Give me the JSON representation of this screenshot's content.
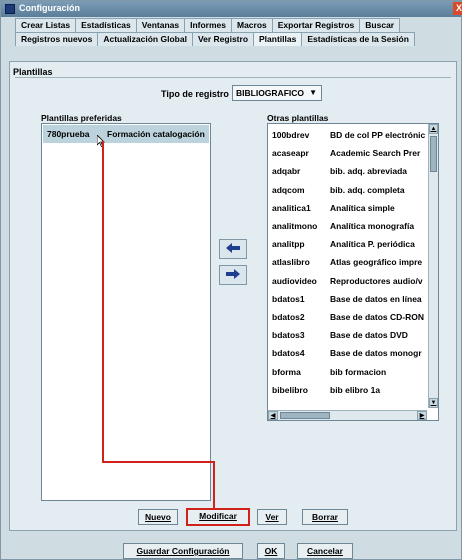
{
  "window": {
    "title": "Configuración",
    "close_label": "X"
  },
  "tabs_row1": [
    {
      "label": "Crear Listas"
    },
    {
      "label": "Estadísticas"
    },
    {
      "label": "Ventanas"
    },
    {
      "label": "Informes"
    },
    {
      "label": "Macros"
    },
    {
      "label": "Exportar Registros"
    },
    {
      "label": "Buscar"
    }
  ],
  "tabs_row2": [
    {
      "label": "Registros nuevos"
    },
    {
      "label": "Actualización Global"
    },
    {
      "label": "Ver Registro"
    },
    {
      "label": "Plantillas",
      "active": true
    },
    {
      "label": "Estadísticas de la Sesión"
    }
  ],
  "section": {
    "title": "Plantillas"
  },
  "tipo_registro": {
    "label": "Tipo de registro",
    "value": "BIBLIOGRAFICO",
    "arrow": "▼"
  },
  "preferidas": {
    "label": "Plantillas preferidas",
    "rows": [
      {
        "code": "780prueba",
        "name": "Formación catalogación"
      }
    ]
  },
  "otras": {
    "label": "Otras plantillas",
    "rows": [
      {
        "code": "100bdrev",
        "name": "BD de col PP electrónic"
      },
      {
        "code": "acaseapr",
        "name": "Academic Search Prer"
      },
      {
        "code": "adqabr",
        "name": "bib. adq. abreviada"
      },
      {
        "code": "adqcom",
        "name": "bib. adq. completa"
      },
      {
        "code": "analitica1",
        "name": "Analítica simple"
      },
      {
        "code": "analitmono",
        "name": "Analítica monografía"
      },
      {
        "code": "analitpp",
        "name": "Analítica P. periódica"
      },
      {
        "code": "atlaslibro",
        "name": "Atlas geográfico impre"
      },
      {
        "code": "audiovideo",
        "name": "Reproductores audio/v"
      },
      {
        "code": "bdatos1",
        "name": "Base de datos en línea"
      },
      {
        "code": "bdatos2",
        "name": "Base de datos CD-RON"
      },
      {
        "code": "bdatos3",
        "name": "Base de datos DVD"
      },
      {
        "code": "bdatos4",
        "name": "Base de datos monogr"
      },
      {
        "code": "bforma",
        "name": "bib formacion"
      },
      {
        "code": "bibelibro",
        "name": "bib elibro 1a"
      }
    ]
  },
  "buttons": {
    "nuevo": "Nuevo",
    "modificar": "Modificar",
    "ver": "Ver",
    "borrar": "Borrar",
    "guardar": "Guardar Configuración",
    "ok": "OK",
    "cancelar": "Cancelar"
  },
  "icons": {
    "move_left": "arrow-left-icon",
    "move_right": "arrow-right-icon"
  },
  "colors": {
    "highlight": "#d0211b",
    "selection": "#bcd2dc",
    "arrow": "#1c3f8f"
  }
}
